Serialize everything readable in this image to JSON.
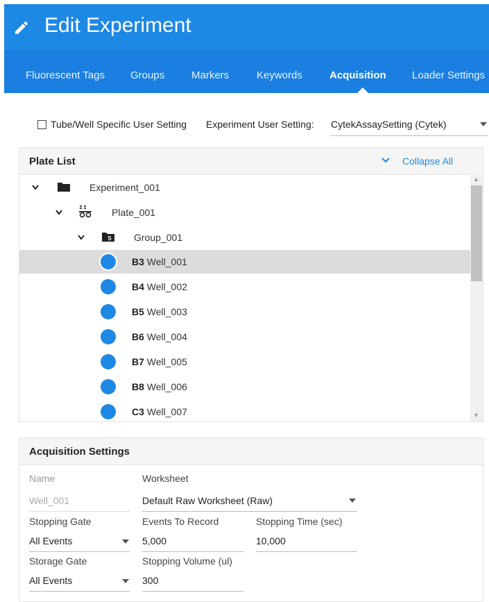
{
  "header": {
    "title": "Edit Experiment",
    "icon": "pencil-icon",
    "color": "#1e88e5",
    "tabs": [
      {
        "label": "Fluorescent Tags",
        "active": false
      },
      {
        "label": "Groups",
        "active": false
      },
      {
        "label": "Markers",
        "active": false
      },
      {
        "label": "Keywords",
        "active": false
      },
      {
        "label": "Acquisition",
        "active": true
      },
      {
        "label": "Loader Settings",
        "active": false
      }
    ]
  },
  "settings": {
    "tube_well_label": "Tube/Well Specific User Setting",
    "tube_well_checked": false,
    "experiment_user_setting_label": "Experiment User Setting:",
    "experiment_user_setting_value": "CytekAssaySetting (Cytek)"
  },
  "plate_list": {
    "title": "Plate List",
    "collapse_label": "Collapse All",
    "experiment": "Experiment_001",
    "plate": "Plate_001",
    "group": "Group_001",
    "wells": [
      {
        "pos": "B3",
        "name": "Well_001",
        "selected": true
      },
      {
        "pos": "B4",
        "name": "Well_002",
        "selected": false
      },
      {
        "pos": "B5",
        "name": "Well_003",
        "selected": false
      },
      {
        "pos": "B6",
        "name": "Well_004",
        "selected": false
      },
      {
        "pos": "B7",
        "name": "Well_005",
        "selected": false
      },
      {
        "pos": "B8",
        "name": "Well_006",
        "selected": false
      },
      {
        "pos": "C3",
        "name": "Well_007",
        "selected": false
      }
    ]
  },
  "acquisition": {
    "title": "Acquisition Settings",
    "name_label": "Name",
    "name_value": "Well_001",
    "worksheet_label": "Worksheet",
    "worksheet_value": "Default Raw Worksheet (Raw)",
    "stopping_gate_label": "Stopping Gate",
    "stopping_gate_value": "All Events",
    "events_to_record_label": "Events To Record",
    "events_to_record_value": "5,000",
    "stopping_time_label": "Stopping Time (sec)",
    "stopping_time_value": "10,000",
    "storage_gate_label": "Storage Gate",
    "storage_gate_value": "All Events",
    "stopping_volume_label": "Stopping Volume (ul)",
    "stopping_volume_value": "300"
  }
}
